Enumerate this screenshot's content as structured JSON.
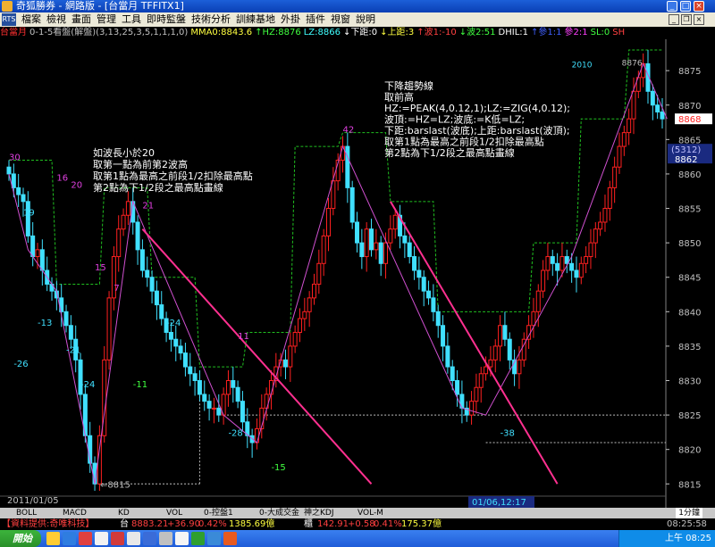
{
  "window": {
    "title": "奇狐勝券 - 網路版 - [台當月 TFFITX1]",
    "min_glyph": "_",
    "max_glyph": "□",
    "close_glyph": "×"
  },
  "menu": {
    "logo_text": "RTS",
    "items": [
      "檔案",
      "檢視",
      "畫面",
      "管理",
      "工具",
      "即時監盤",
      "技術分析",
      "訓練基地",
      "外掛",
      "插件",
      "視窗",
      "說明"
    ],
    "mdi_min": "_",
    "mdi_restore": "❐",
    "mdi_close": "×"
  },
  "statusline": [
    {
      "text": "台當月",
      "color": "#ff3030"
    },
    {
      "text": "0-1-5看盤(解盤)(3,13,25,3,5,1,1,1,0)",
      "color": "#c0c0c0"
    },
    {
      "text": "MMA0:8843.6",
      "color": "#ffff40"
    },
    {
      "text": "↑HZ:8876",
      "color": "#40ff40"
    },
    {
      "text": "LZ:8866",
      "color": "#40ffff"
    },
    {
      "text": "↓下距:0",
      "color": "#ffffff"
    },
    {
      "text": "↓上距:3",
      "color": "#ffff40"
    },
    {
      "text": "↑波1:-10",
      "color": "#ff4040"
    },
    {
      "text": "↓波2:51",
      "color": "#40ff40"
    },
    {
      "text": "DHIL:1",
      "color": "#ffffff"
    },
    {
      "text": "↑參1:1",
      "color": "#4060ff"
    },
    {
      "text": "參2:1",
      "color": "#ff40ff"
    },
    {
      "text": "SL:0",
      "color": "#40ff40"
    },
    {
      "text": "SH",
      "color": "#ff4040"
    }
  ],
  "chart_data": {
    "type": "candlestick",
    "title": "",
    "ylim": [
      8814,
      8878
    ],
    "y_ticks": [
      8815,
      8820,
      8825,
      8830,
      8835,
      8840,
      8845,
      8850,
      8855,
      8860,
      8865,
      8870,
      8875
    ],
    "grid": false,
    "last_price": 8868,
    "price_badge": "(5312)",
    "price_label_2": "8862",
    "date_left": "2011/01/05",
    "date_cursor": "01/06,12:17",
    "year_label": "2010",
    "price_low_label": "8815",
    "price_high_label": "8876",
    "magenta_labels": [
      "30",
      "16",
      "20",
      "21",
      "42",
      "15",
      "7",
      "11"
    ],
    "cyan_labels": [
      "19",
      "-13",
      "-21",
      "-26",
      "-24",
      "-24",
      "-28",
      "-38"
    ],
    "green_labels": [
      "-11",
      "-15"
    ],
    "annotation_left": [
      "如波長小於20",
      "取第一點為前第2波高",
      "取第1點為最高之前段1/2扣除最高點",
      "第2點為下1/2段之最高點畫線"
    ],
    "annotation_right": [
      "下降趨勢線",
      "取前高",
      "HZ:=PEAK(4,0.12,1);LZ:=ZIG(4,0.12);",
      "波頂:=HZ=LZ;波底:=K低=LZ;",
      "下距:barslast(波底);上距:barslast(波頂);",
      "取第1點為最高之前段1/2扣除最高點",
      "第2點為下1/2段之最高點畫線"
    ],
    "zigzag_points": [
      [
        0,
        8860
      ],
      [
        4,
        8849
      ],
      [
        10,
        8843
      ],
      [
        18,
        8815
      ],
      [
        26,
        8856
      ],
      [
        45,
        8825
      ],
      [
        52,
        8821
      ],
      [
        70,
        8864
      ],
      [
        95,
        8826
      ],
      [
        100,
        8825
      ],
      [
        118,
        8848
      ],
      [
        133,
        8876
      ],
      [
        138,
        8868
      ]
    ],
    "trendlines": [
      {
        "from": [
          28,
          8852
        ],
        "to": [
          76,
          8815
        ]
      },
      {
        "from": [
          80,
          8856
        ],
        "to": [
          115,
          8815
        ]
      }
    ],
    "series": [
      {
        "name": "close",
        "values": [
          8860,
          8858,
          8857,
          8856,
          8851,
          8848,
          8849,
          8846,
          8844,
          8843,
          8842,
          8840,
          8838,
          8836,
          8833,
          8828,
          8822,
          8818,
          8815,
          8822,
          8833,
          8842,
          8848,
          8852,
          8854,
          8856,
          8853,
          8849,
          8846,
          8845,
          8843,
          8841,
          8839,
          8837,
          8836,
          8835,
          8834,
          8832,
          8831,
          8830,
          8828,
          8827,
          8826,
          8826,
          8825,
          8828,
          8830,
          8829,
          8827,
          8824,
          8822,
          8821,
          8823,
          8826,
          8828,
          8830,
          8832,
          8833,
          8832,
          8835,
          8837,
          8839,
          8840,
          8842,
          8844,
          8847,
          8851,
          8855,
          8859,
          8862,
          8864,
          8858,
          8853,
          8850,
          8848,
          8852,
          8849,
          8850,
          8847,
          8850,
          8852,
          8854,
          8851,
          8850,
          8848,
          8846,
          8845,
          8843,
          8842,
          8840,
          8838,
          8835,
          8832,
          8830,
          8828,
          8826,
          8825,
          8827,
          8829,
          8831,
          8832,
          8833,
          8835,
          8838,
          8836,
          8833,
          8831,
          8833,
          8836,
          8838,
          8840,
          8843,
          8846,
          8848,
          8847,
          8846,
          8848,
          8847,
          8846,
          8845,
          8847,
          8848,
          8850,
          8852,
          8853,
          8855,
          8858,
          8861,
          8864,
          8866,
          8868,
          8872,
          8874,
          8876,
          8872,
          8870,
          8869,
          8868
        ]
      }
    ]
  },
  "tabs": [
    "BOLL",
    "MACD",
    "KD",
    "VOL",
    "0-控盤1",
    "0-大成交金",
    "神之KDJ",
    "VOL-M"
  ],
  "period": "1分鐘",
  "quotebar": {
    "source_label": "【資料提供:奇唯科技】",
    "index_name": "台",
    "index_value": "8883.21",
    "index_change": "+36.90",
    "index_pct": "0.42%",
    "index_volume": "1385.69億",
    "otc_name": "櫃",
    "otc_value": "142.91",
    "otc_change": "+0.58",
    "otc_pct": "0.41%",
    "otc_volume": "175.37億",
    "time": "08:25:58"
  },
  "taskbar": {
    "start_label": "開始",
    "clock": "上午 08:25"
  }
}
